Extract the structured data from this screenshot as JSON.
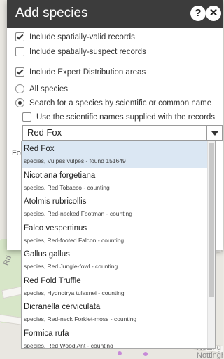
{
  "dialog": {
    "title": "Add species",
    "help_icon": "question-circle-icon",
    "close_icon": "close-circle-icon"
  },
  "options": {
    "spatially_valid": {
      "label": "Include spatially-valid records",
      "checked": true
    },
    "spatially_suspect": {
      "label": "Include spatially-suspect records",
      "checked": false
    },
    "expert_distribution": {
      "label": "Include Expert Distribution areas",
      "checked": true
    },
    "all_species": {
      "label": "All species",
      "selected": false
    },
    "search_species": {
      "label": "Search for a species by scientific or common name",
      "selected": true
    },
    "use_scientific_names": {
      "label": "Use the scientific names supplied with the records",
      "checked": false
    }
  },
  "search": {
    "value": "Red Fox",
    "clipped_label": "Fo"
  },
  "results": [
    {
      "name": "Red Fox",
      "desc": "species, Vulpes vulpes - found 151649"
    },
    {
      "name": "Nicotiana forgetiana",
      "desc": "species, Red Tobacco - counting"
    },
    {
      "name": "Atolmis rubricollis",
      "desc": "species, Red-necked Footman - counting"
    },
    {
      "name": "Falco vespertinus",
      "desc": "species, Red-footed Falcon - counting"
    },
    {
      "name": "Gallus gallus",
      "desc": "species, Red Jungle-fowl - counting"
    },
    {
      "name": "Red Fold Truffle",
      "desc": "species, Hydnotrya tulasnei - counting"
    },
    {
      "name": "Dicranella cerviculata",
      "desc": "species, Red-neck Forklet-moss - counting"
    },
    {
      "name": "Formica rufa",
      "desc": "species, Red Wood Ant - counting"
    }
  ],
  "map": {
    "labels": [
      "Notting",
      "Nottingh",
      "Rd"
    ]
  },
  "colors": {
    "titlebar": "#3c3c3c",
    "selected_row": "#dbe7f3"
  }
}
